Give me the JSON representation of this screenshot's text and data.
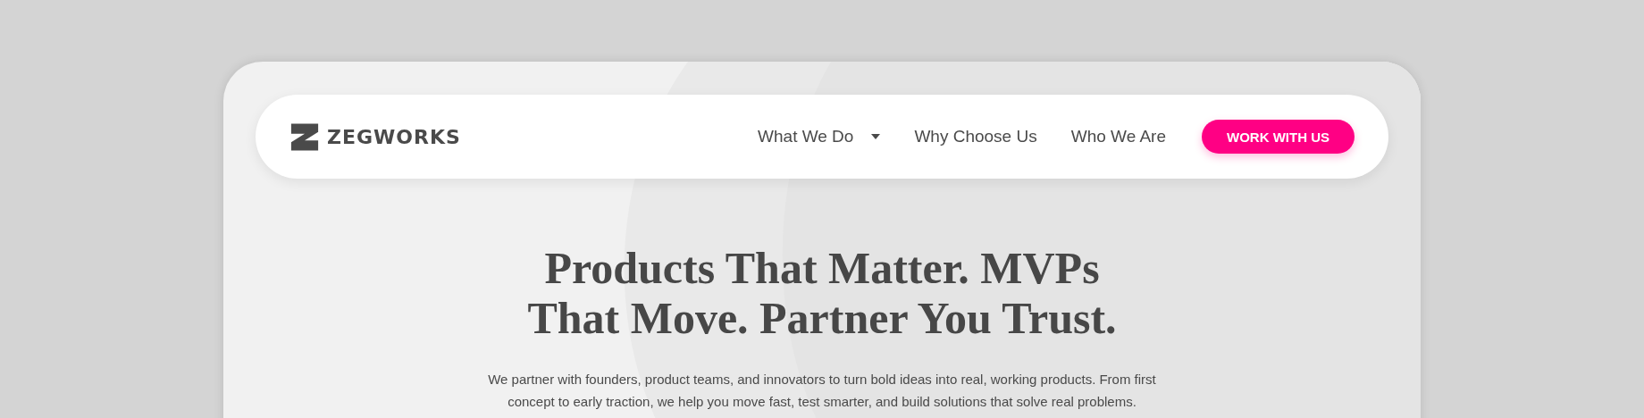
{
  "brand": {
    "name": "ZEGWORKS"
  },
  "nav": {
    "items": [
      {
        "label": "What We Do",
        "kind": "dropdown"
      },
      {
        "label": "Why Choose Us",
        "kind": "link"
      },
      {
        "label": "Who We Are",
        "kind": "link"
      }
    ],
    "cta": "WORK WITH US"
  },
  "hero": {
    "title": "Products That Matter. MVPs That Move. Partner You Trust.",
    "text": "We partner with founders, product teams, and innovators to turn bold ideas into real, working products. From first concept to early traction, we help you move fast, test smarter, and build solutions that solve real problems."
  }
}
